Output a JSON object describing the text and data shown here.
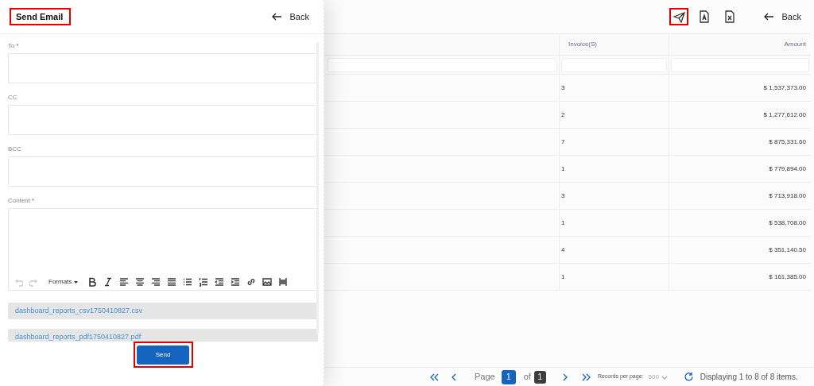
{
  "email_panel": {
    "title": "Send Email",
    "title_highlighted": true,
    "back": "Back",
    "fields": [
      {
        "label": "To",
        "required_mark": "*"
      },
      {
        "label": "CC"
      },
      {
        "label": "BCC"
      }
    ],
    "content": {
      "label": "Content",
      "required_mark": "*"
    },
    "editor_tools": [
      {
        "kind": "undo",
        "disabled": true
      },
      {
        "kind": "redo",
        "disabled": true
      },
      {
        "kind": "formats",
        "label": "Formats",
        "disabled": false
      },
      {
        "kind": "bold",
        "disabled": false
      },
      {
        "kind": "italic",
        "disabled": false
      },
      {
        "kind": "align-left",
        "disabled": false
      },
      {
        "kind": "align-center",
        "disabled": false
      },
      {
        "kind": "align-right",
        "disabled": false
      },
      {
        "kind": "justify",
        "disabled": false
      },
      {
        "kind": "bullet-list",
        "disabled": false
      },
      {
        "kind": "numbered-list",
        "disabled": false
      },
      {
        "kind": "outdent",
        "disabled": false
      },
      {
        "kind": "indent",
        "disabled": false
      },
      {
        "kind": "link",
        "disabled": false
      },
      {
        "kind": "image",
        "disabled": false
      },
      {
        "kind": "rule",
        "disabled": false
      }
    ],
    "attachments": [
      "dashboard_reports_csv1750410827.csv",
      "dashboard_reports_pdf1750410827.pdf"
    ],
    "send": {
      "label": "Send",
      "highlighted": true
    }
  },
  "toolbar": {
    "actions": [
      {
        "kind": "send",
        "highlighted": true
      },
      {
        "kind": "pdf",
        "highlighted": false
      },
      {
        "kind": "excel",
        "highlighted": false
      }
    ],
    "back": "Back"
  },
  "table": {
    "columns": [
      "Invoice(S)",
      "Amount"
    ],
    "rows": [
      [
        "3",
        "$ 1,537,373.00"
      ],
      [
        "2",
        "$ 1,277,612.00"
      ],
      [
        "7",
        "$ 875,331.60"
      ],
      [
        "1",
        "$ 779,894.00"
      ],
      [
        "3",
        "$ 713,918.00"
      ],
      [
        "1",
        "$ 538,708.00"
      ],
      [
        "4",
        "$ 351,140.50"
      ],
      [
        "1",
        "$ 161,385.00"
      ]
    ]
  },
  "pagination": {
    "page_label": "Page",
    "page": "1",
    "of": "of",
    "total": "1",
    "records_label": "Records per page:",
    "records": "500",
    "summary": "Displaying 1 to 8 of 8 items."
  }
}
